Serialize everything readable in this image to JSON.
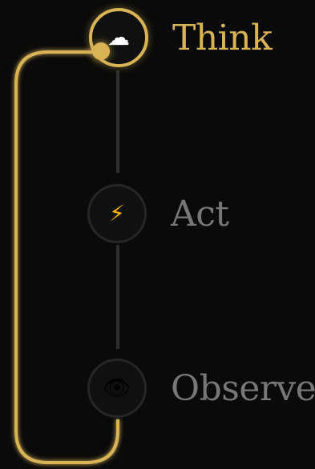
{
  "steps": [
    {
      "label": "Think",
      "icon": "thought-cloud",
      "glyph": "☁",
      "active": true
    },
    {
      "label": "Act",
      "icon": "lightning",
      "glyph": "⚡",
      "active": false
    },
    {
      "label": "Observe",
      "icon": "eye",
      "glyph": "👁",
      "active": false
    }
  ],
  "colors": {
    "background": "#0a0a0a",
    "accent": "#d8b457",
    "inactive_text": "#777777",
    "connector": "#2e2e2e"
  }
}
